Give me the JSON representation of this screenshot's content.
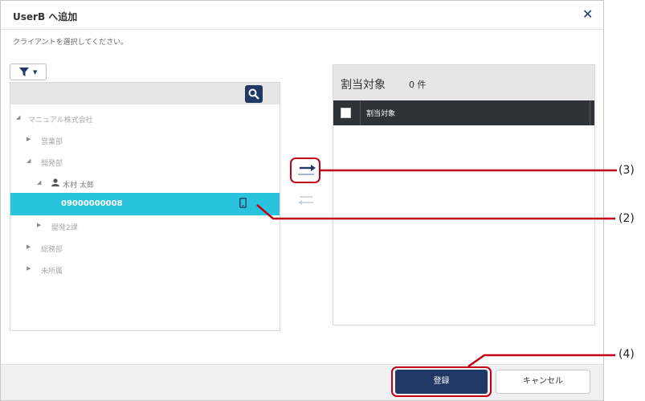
{
  "dialog": {
    "title": "UserB へ追加",
    "instruction": "クライアントを選択してください。"
  },
  "tree": {
    "items": [
      {
        "label": "マニュアル株式会社",
        "level": 0,
        "expanded": true
      },
      {
        "label": "営業部",
        "level": 1,
        "expanded": false
      },
      {
        "label": "開発部",
        "level": 1,
        "expanded": true
      },
      {
        "label": "木村 太郎",
        "level": 2,
        "expanded": true
      },
      {
        "label": "09000000008",
        "level": 3,
        "selected": true
      },
      {
        "label": "開発2課",
        "level": 2,
        "expanded": false
      },
      {
        "label": "総務部",
        "level": 1,
        "expanded": false
      },
      {
        "label": "未所属",
        "level": 1,
        "expanded": false
      }
    ]
  },
  "assign": {
    "title": "割当対象",
    "count": "0 件",
    "column": "割当対象"
  },
  "footer": {
    "register": "登録",
    "cancel": "キャンセル"
  },
  "callouts": {
    "c3": "(3)",
    "c2": "(2)",
    "c4": "(4)"
  },
  "colors": {
    "accent": "#1f3864",
    "selection": "#29c3dd",
    "highlight": "#c00018"
  }
}
